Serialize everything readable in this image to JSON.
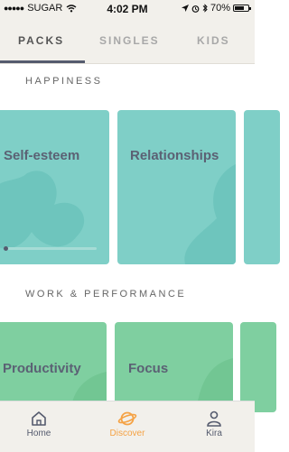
{
  "status_bar": {
    "carrier": "SUGAR",
    "time": "4:02 PM",
    "battery": "70%",
    "battery_level": 0.7
  },
  "tabs": [
    {
      "label": "PACKS",
      "active": true
    },
    {
      "label": "SINGLES",
      "active": false
    },
    {
      "label": "KIDS",
      "active": false
    }
  ],
  "sections": [
    {
      "title": "HAPPINESS",
      "cards": [
        {
          "title": "Self-esteem"
        },
        {
          "title": "Relationships"
        }
      ]
    },
    {
      "title": "WORK & PERFORMANCE",
      "cards": [
        {
          "title": "Productivity"
        },
        {
          "title": "Focus"
        }
      ]
    }
  ],
  "bottom_nav": [
    {
      "label": "Home",
      "icon": "home-icon",
      "active": false
    },
    {
      "label": "Discover",
      "icon": "discover-icon",
      "active": true
    },
    {
      "label": "Kira",
      "icon": "profile-icon",
      "active": false
    }
  ],
  "colors": {
    "teal_card": "#7fcfc7",
    "green_card": "#7fcfa0",
    "accent": "#f5a244",
    "text_dark": "#555b6e"
  }
}
